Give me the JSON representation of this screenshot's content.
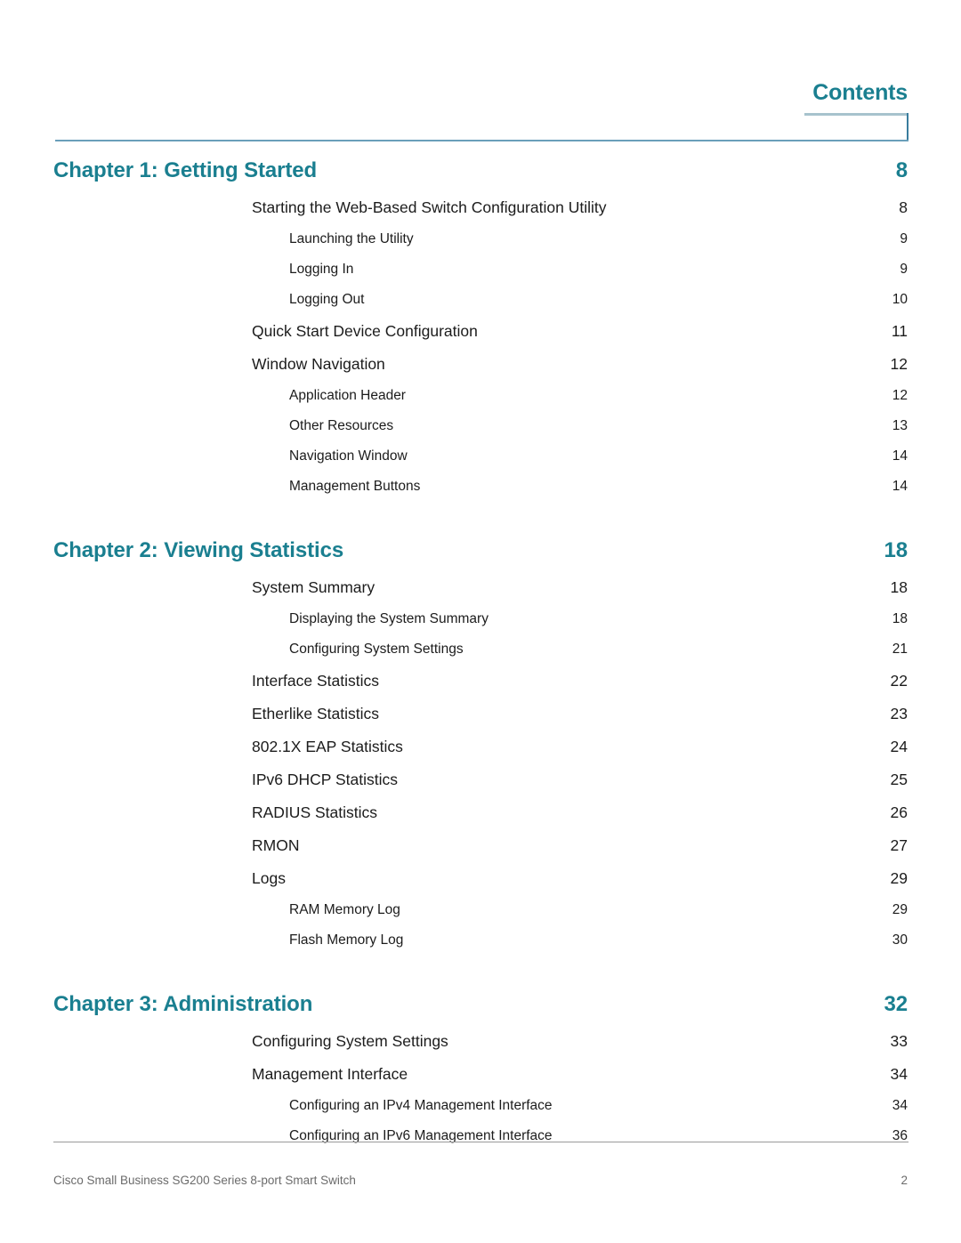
{
  "header": {
    "title": "Contents"
  },
  "toc": {
    "entries": [
      {
        "level": "chapter",
        "label": "Chapter 1: Getting Started",
        "page": "8",
        "gap": false
      },
      {
        "level": "lvl1",
        "label": "Starting the Web-Based Switch Configuration Utility",
        "page": "8"
      },
      {
        "level": "lvl2",
        "label": "Launching the Utility",
        "page": "9"
      },
      {
        "level": "lvl2",
        "label": "Logging In",
        "page": "9"
      },
      {
        "level": "lvl2",
        "label": "Logging Out",
        "page": "10"
      },
      {
        "level": "lvl1",
        "label": "Quick Start Device Configuration",
        "page": "11"
      },
      {
        "level": "lvl1",
        "label": "Window Navigation",
        "page": "12"
      },
      {
        "level": "lvl2",
        "label": "Application Header",
        "page": "12"
      },
      {
        "level": "lvl2",
        "label": "Other Resources",
        "page": "13"
      },
      {
        "level": "lvl2",
        "label": "Navigation Window",
        "page": "14"
      },
      {
        "level": "lvl2",
        "label": "Management Buttons",
        "page": "14"
      },
      {
        "level": "chapter",
        "label": "Chapter 2: Viewing Statistics",
        "page": "18",
        "gap": true
      },
      {
        "level": "lvl1",
        "label": "System Summary",
        "page": "18"
      },
      {
        "level": "lvl2",
        "label": "Displaying the System Summary",
        "page": "18"
      },
      {
        "level": "lvl2",
        "label": "Configuring System Settings",
        "page": "21"
      },
      {
        "level": "lvl1",
        "label": "Interface Statistics",
        "page": "22"
      },
      {
        "level": "lvl1",
        "label": "Etherlike Statistics",
        "page": "23"
      },
      {
        "level": "lvl1",
        "label": "802.1X EAP Statistics",
        "page": "24"
      },
      {
        "level": "lvl1",
        "label": "IPv6 DHCP Statistics",
        "page": "25"
      },
      {
        "level": "lvl1",
        "label": "RADIUS Statistics",
        "page": "26"
      },
      {
        "level": "lvl1",
        "label": "RMON",
        "page": "27"
      },
      {
        "level": "lvl1",
        "label": "Logs",
        "page": "29"
      },
      {
        "level": "lvl2",
        "label": "RAM Memory Log",
        "page": "29"
      },
      {
        "level": "lvl2",
        "label": "Flash Memory Log",
        "page": "30"
      },
      {
        "level": "chapter",
        "label": "Chapter 3: Administration",
        "page": "32",
        "gap": true
      },
      {
        "level": "lvl1",
        "label": "Configuring System Settings",
        "page": "33"
      },
      {
        "level": "lvl1",
        "label": "Management Interface",
        "page": "34"
      },
      {
        "level": "lvl2",
        "label": "Configuring an IPv4 Management Interface",
        "page": "34"
      },
      {
        "level": "lvl2",
        "label": "Configuring an IPv6 Management Interface",
        "page": "36"
      }
    ]
  },
  "footer": {
    "product": "Cisco Small Business SG200 Series 8-port Smart Switch",
    "page_number": "2"
  },
  "colors": {
    "heading_teal": "#1a7f90",
    "rule_blue": "#6a9fba",
    "rule_light": "#a7c3cd",
    "body_text": "#1c1c1c",
    "footer_text": "#6b6b6b"
  }
}
